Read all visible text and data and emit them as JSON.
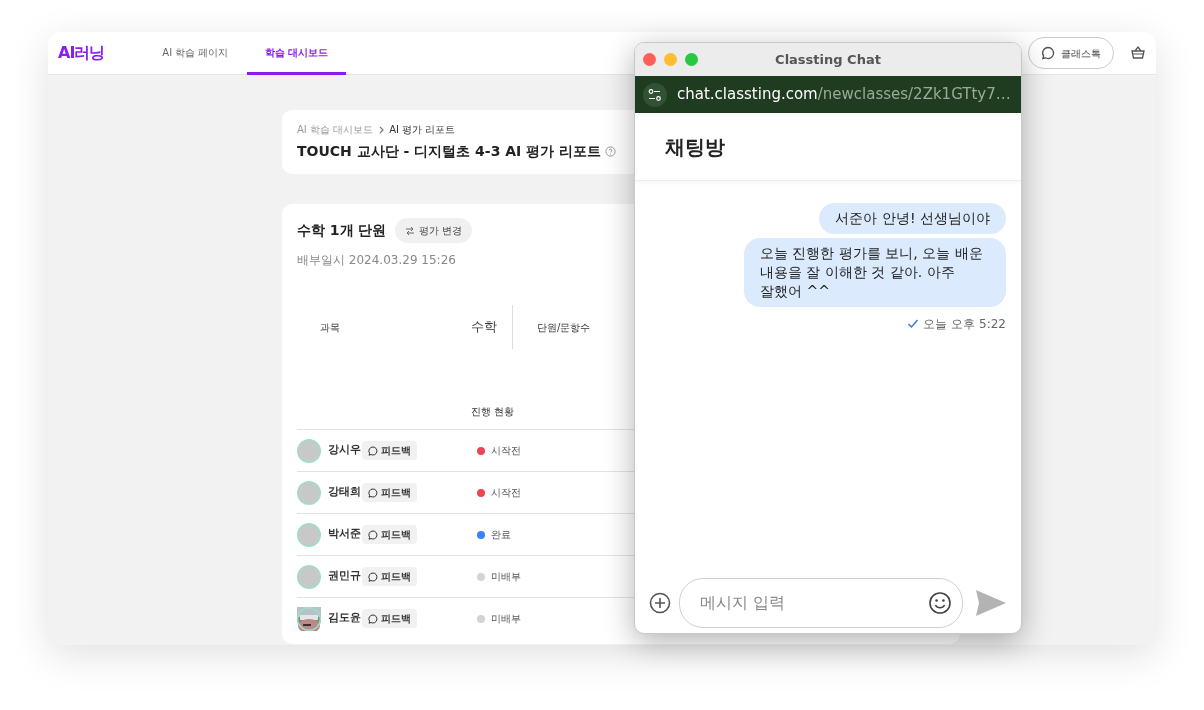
{
  "app": {
    "logo": "AI러닝",
    "tabs": [
      {
        "label": "AI 학습 페이지",
        "selected": false
      },
      {
        "label": "학습 대시보드",
        "selected": true
      }
    ],
    "chat_button": "클래스톡"
  },
  "report_header": {
    "breadcrumb": [
      "AI 학습 대시보드",
      "AI 평가 리포트"
    ],
    "title": "TOUCH 교사단 - 디지털초 4-3 AI 평가 리포트"
  },
  "assessment": {
    "title": "수학 1개 단원",
    "change_button": "평가 변경",
    "assigned": "배부일시 2024.03.29 15:26",
    "info": {
      "subject_label": "과목",
      "subject_value": "수학",
      "units_label": "단원/문항수"
    },
    "progress_header": "진행 현황",
    "students": [
      {
        "name": "강시우",
        "kind": "avatar",
        "feedback": "피드백",
        "status": "시작전",
        "color": "#f04452"
      },
      {
        "name": "강태희",
        "kind": "avatar",
        "feedback": "피드백",
        "status": "시작전",
        "color": "#f04452"
      },
      {
        "name": "박서준",
        "kind": "avatar",
        "feedback": "피드백",
        "status": "완료",
        "color": "#3b82f6"
      },
      {
        "name": "권민규",
        "kind": "avatar",
        "feedback": "피드백",
        "status": "미배부",
        "color": "#d4d4d4"
      },
      {
        "name": "김도윤",
        "kind": "picture",
        "feedback": "피드백",
        "status": "미배부",
        "color": "#d4d4d4"
      }
    ]
  },
  "chat_window": {
    "title": "Classting Chat",
    "url_host": "chat.classting.com",
    "url_path": "/newclasses/2Zk1GTty7…",
    "room_title": "채팅방",
    "messages": [
      {
        "text": "서준아 안녕! 선생님이야"
      },
      {
        "text": "오늘 진행한 평가를 보니, 오늘 배운 내용을 잘 이해한 것 같아. 아주 잘했어 ^^"
      }
    ],
    "read": true,
    "time": "오늘 오후 5:22",
    "input": {
      "placeholder": "메시지 입력"
    }
  }
}
